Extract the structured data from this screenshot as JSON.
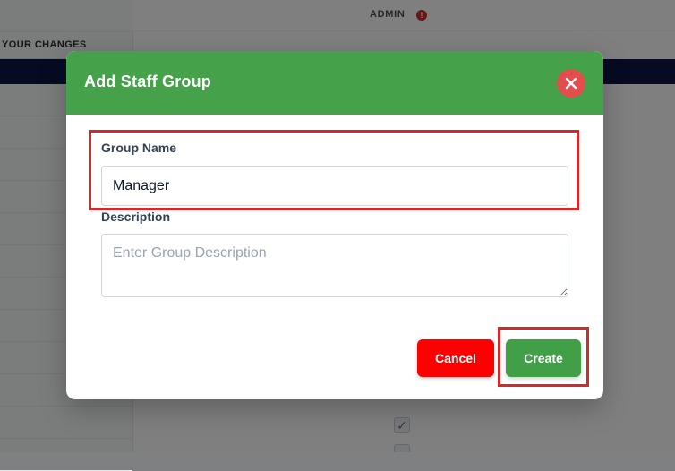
{
  "background": {
    "left_panel_text": "YOUR CHANGES",
    "header_user": "ADMIN",
    "info_icon": "info-icon"
  },
  "modal": {
    "title": "Add Staff Group",
    "close_icon": "close-icon",
    "group_name": {
      "label": "Group Name",
      "value": "Manager"
    },
    "description": {
      "label": "Description",
      "placeholder": "Enter Group Description",
      "value": ""
    },
    "buttons": {
      "cancel": "Cancel",
      "create": "Create"
    }
  },
  "colors": {
    "header_green": "#45a24a",
    "cancel_red": "#ff0000",
    "create_green": "#41a047",
    "highlight_red": "#d62828",
    "navy_bar": "#0f1642"
  }
}
